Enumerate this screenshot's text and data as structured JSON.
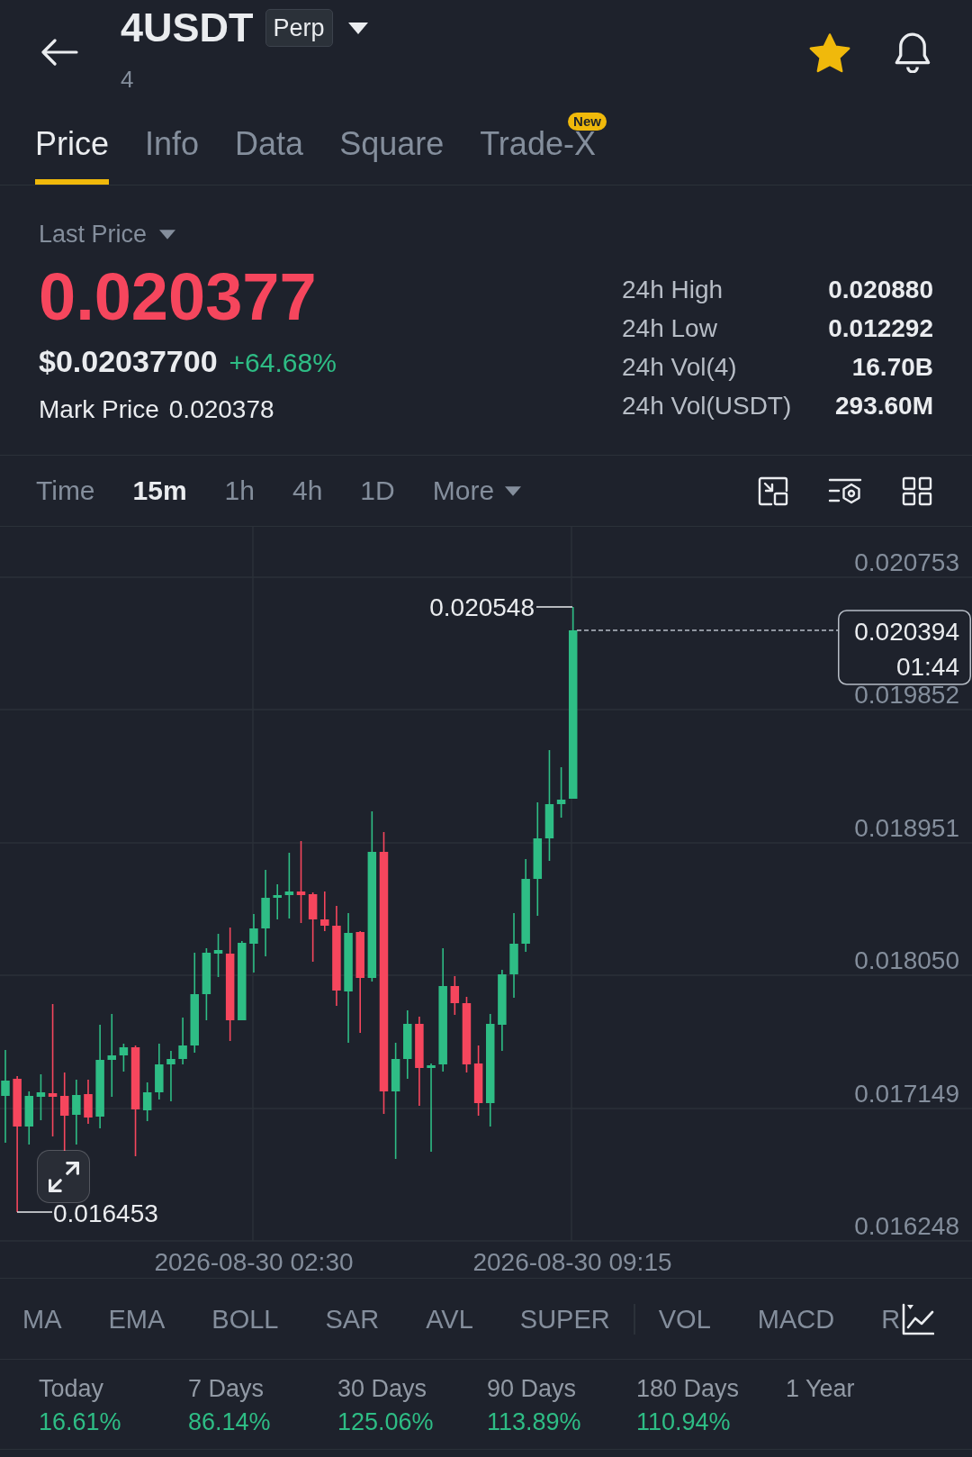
{
  "header": {
    "symbol": "4USDT",
    "contract_badge": "Perp",
    "subtitle": "4",
    "favorite": true
  },
  "tabs": [
    {
      "label": "Price",
      "selected": true
    },
    {
      "label": "Info",
      "selected": false
    },
    {
      "label": "Data",
      "selected": false
    },
    {
      "label": "Square",
      "selected": false
    },
    {
      "label": "Trade-X",
      "selected": false,
      "badge": "New"
    }
  ],
  "price_panel": {
    "price_type": "Last Price",
    "last_price": "0.020377",
    "last_tick_down": true,
    "usd_price": "$0.02037700",
    "change": "+64.68%",
    "mark_price_label": "Mark Price",
    "mark_price": "0.020378",
    "stats": [
      {
        "label": "24h High",
        "value": "0.020880"
      },
      {
        "label": "24h Low",
        "value": "0.012292"
      },
      {
        "label": "24h Vol(4)",
        "value": "16.70B"
      },
      {
        "label": "24h Vol(USDT)",
        "value": "293.60M"
      }
    ]
  },
  "chart_toolbar": {
    "intervals": [
      {
        "label": "Time",
        "selected": false
      },
      {
        "label": "15m",
        "selected": true
      },
      {
        "label": "1h",
        "selected": false
      },
      {
        "label": "4h",
        "selected": false
      },
      {
        "label": "1D",
        "selected": false
      }
    ],
    "more": "More"
  },
  "chart": {
    "y_axis_labels": [
      "0.020753",
      "0.019852",
      "0.018951",
      "0.018050",
      "0.017149",
      "0.016248"
    ],
    "x_axis_labels": [
      "2026-08-30 02:30",
      "2026-08-30 09:15"
    ],
    "high_marker": "0.020548",
    "low_marker": "0.016453",
    "price_tag": {
      "price": "0.020394",
      "countdown": "01:44"
    }
  },
  "indicators": {
    "main": [
      {
        "label": "MA",
        "selected": false
      },
      {
        "label": "EMA",
        "selected": false
      },
      {
        "label": "BOLL",
        "selected": false
      },
      {
        "label": "SAR",
        "selected": false
      },
      {
        "label": "AVL",
        "selected": false
      },
      {
        "label": "SUPER",
        "selected": false
      }
    ],
    "sub": [
      {
        "label": "VOL",
        "selected": false
      },
      {
        "label": "MACD",
        "selected": false
      },
      {
        "label": "R",
        "selected": false
      }
    ]
  },
  "returns": [
    {
      "label": "Today",
      "value": "16.61%"
    },
    {
      "label": "7 Days",
      "value": "86.14%"
    },
    {
      "label": "30 Days",
      "value": "125.06%"
    },
    {
      "label": "90 Days",
      "value": "113.89%"
    },
    {
      "label": "180 Days",
      "value": "110.94%"
    },
    {
      "label": "1 Year"
    }
  ]
}
